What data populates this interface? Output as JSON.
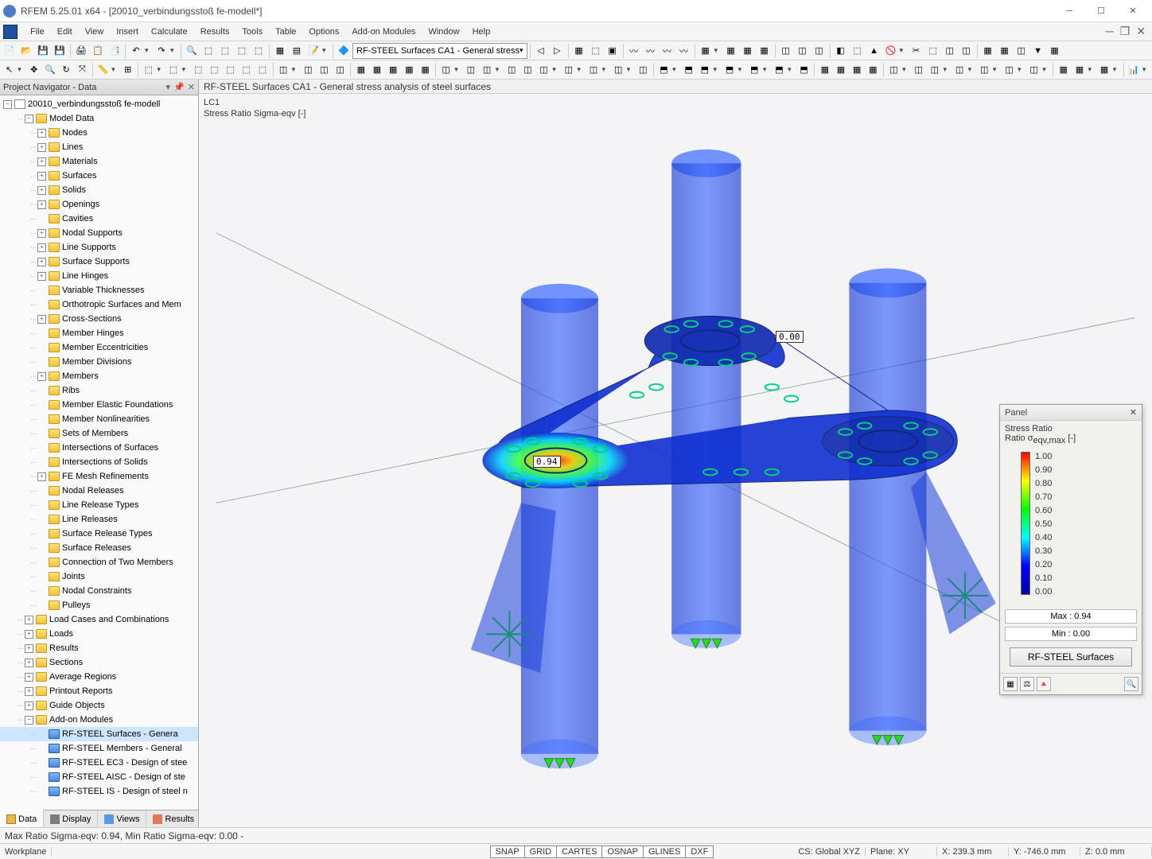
{
  "window": {
    "title": "RFEM 5.25.01 x64 - [20010_verbindungsstoß fe-modell*]"
  },
  "menus": [
    "File",
    "Edit",
    "View",
    "Insert",
    "Calculate",
    "Results",
    "Tools",
    "Table",
    "Options",
    "Add-on Modules",
    "Window",
    "Help"
  ],
  "toolbar2_select": "RF-STEEL Surfaces CA1 - General stress",
  "navigator": {
    "title": "Project Navigator - Data",
    "root": "20010_verbindungsstoß fe-modell",
    "model_data": "Model Data",
    "md_items": [
      "Nodes",
      "Lines",
      "Materials",
      "Surfaces",
      "Solids",
      "Openings",
      "Cavities",
      "Nodal Supports",
      "Line Supports",
      "Surface Supports",
      "Line Hinges",
      "Variable Thicknesses",
      "Orthotropic Surfaces and Mem",
      "Cross-Sections",
      "Member Hinges",
      "Member Eccentricities",
      "Member Divisions",
      "Members",
      "Ribs",
      "Member Elastic Foundations",
      "Member Nonlinearities",
      "Sets of Members",
      "Intersections of Surfaces",
      "Intersections of Solids",
      "FE Mesh Refinements",
      "Nodal Releases",
      "Line Release Types",
      "Line Releases",
      "Surface Release Types",
      "Surface Releases",
      "Connection of Two Members",
      "Joints",
      "Nodal Constraints",
      "Pulleys"
    ],
    "top_items": [
      "Load Cases and Combinations",
      "Loads",
      "Results",
      "Sections",
      "Average Regions",
      "Printout Reports",
      "Guide Objects",
      "Add-on Modules"
    ],
    "addon_items": [
      "RF-STEEL Surfaces - Genera",
      "RF-STEEL Members - General",
      "RF-STEEL EC3 - Design of stee",
      "RF-STEEL AISC - Design of ste",
      "RF-STEEL IS - Design of steel n"
    ],
    "tabs": [
      "Data",
      "Display",
      "Views",
      "Results"
    ]
  },
  "viewport": {
    "header": "RF-STEEL Surfaces CA1 - General stress analysis of steel surfaces",
    "info1": "LC1",
    "info2": "Stress Ratio Sigma-eqv [-]",
    "anno_max": "0.94",
    "anno_min": "0.00"
  },
  "panel": {
    "title": "Panel",
    "subtitle1": "Stress Ratio",
    "subtitle2": "Ratio σ",
    "subtitle2b": "eqv,max",
    "subtitle2c": " [-]",
    "ticks": [
      "1.00",
      "0.90",
      "0.80",
      "0.70",
      "0.60",
      "0.50",
      "0.40",
      "0.30",
      "0.20",
      "0.10",
      "0.00"
    ],
    "max": "Max  :   0.94",
    "min": "Min   :   0.00",
    "button": "RF-STEEL Surfaces"
  },
  "bottom_info": "Max Ratio Sigma-eqv: 0.94, Min Ratio Sigma-eqv: 0.00 -",
  "status": {
    "workplane": "Workplane",
    "snapbtns": [
      "SNAP",
      "GRID",
      "CARTES",
      "OSNAP",
      "GLINES",
      "DXF"
    ],
    "cs": "CS: Global XYZ",
    "plane": "Plane: XY",
    "x": "X:   239.3 mm",
    "y": "Y:  -746.0 mm",
    "z": "Z:  0.0 mm"
  }
}
